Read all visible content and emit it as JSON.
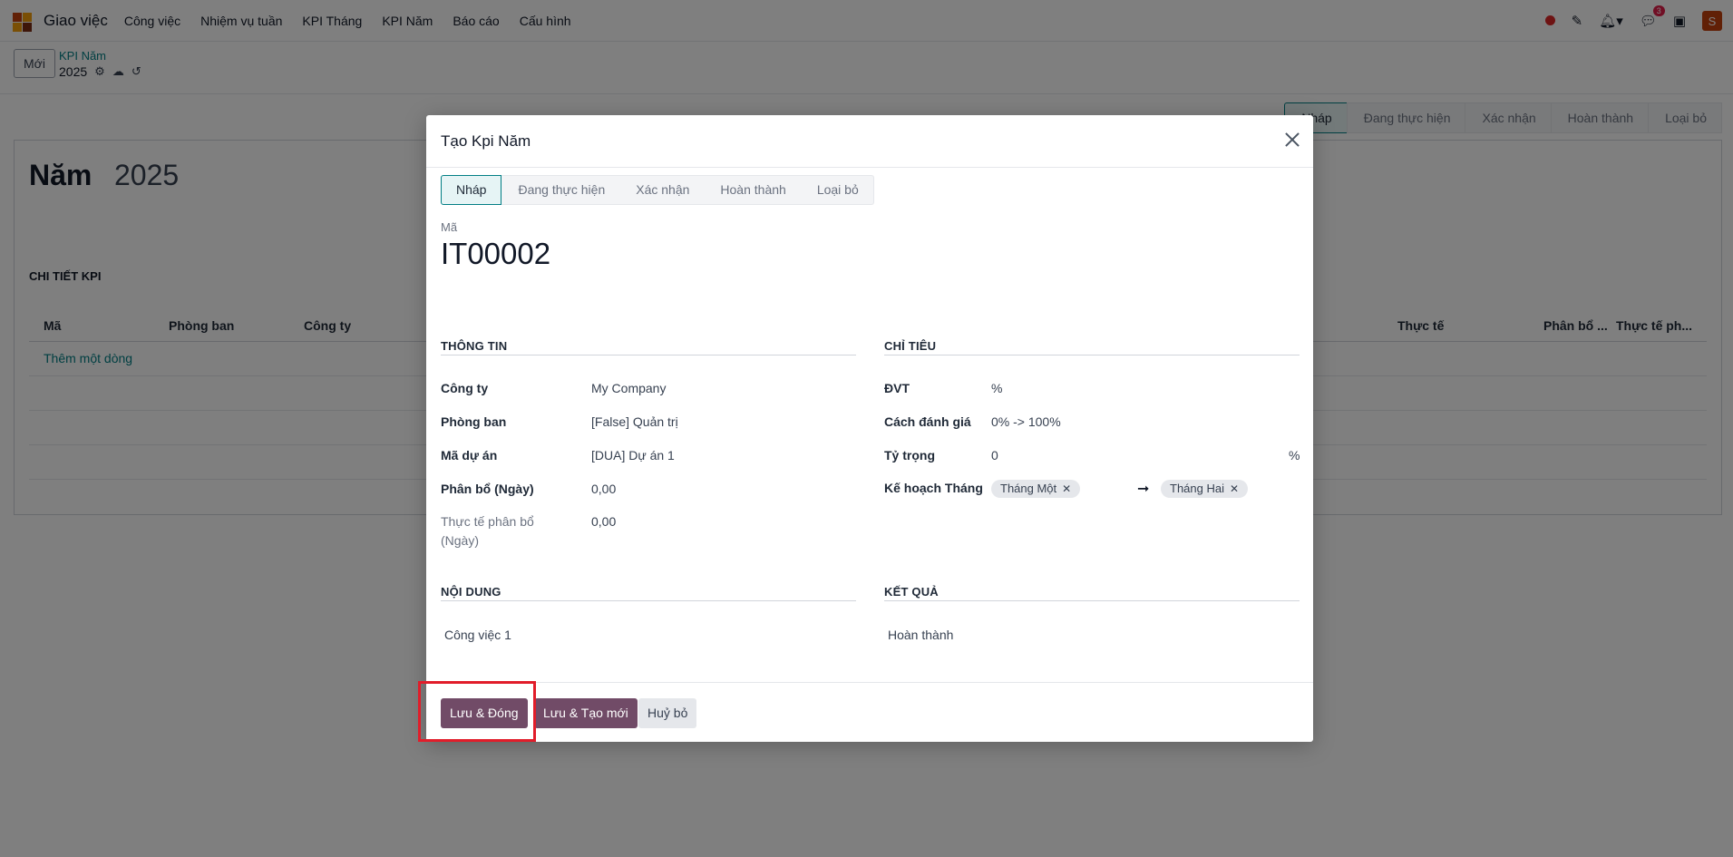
{
  "navbar": {
    "app_name": "Giao việc",
    "menu": [
      "Công việc",
      "Nhiệm vụ tuần",
      "KPI Tháng",
      "KPI Năm",
      "Báo cáo",
      "Cấu hình"
    ],
    "messages_count": "3",
    "avatar_initial": "S"
  },
  "control": {
    "new_button": "Mới",
    "breadcrumb_parent": "KPI Năm",
    "breadcrumb_current": "2025"
  },
  "background_status": [
    "Nháp",
    "Đang thực hiện",
    "Xác nhận",
    "Hoàn thành",
    "Loại bỏ"
  ],
  "sheet": {
    "title_label": "Năm",
    "title_value": "2025",
    "section": "CHI TIẾT KPI",
    "columns": [
      "Mã",
      "Phòng ban",
      "Công ty",
      "Thực tế",
      "Phân bổ ...",
      "Thực tế ph..."
    ],
    "add_line": "Thêm một dòng"
  },
  "modal": {
    "title": "Tạo Kpi Năm",
    "status": [
      "Nháp",
      "Đang thực hiện",
      "Xác nhận",
      "Hoàn thành",
      "Loại bỏ"
    ],
    "code_label": "Mã",
    "code_value": "IT00002",
    "info": {
      "title": "THÔNG TIN",
      "company_label": "Công ty",
      "company_value": "My Company",
      "department_label": "Phòng ban",
      "department_value": "[False] Quản trị",
      "project_label": "Mã dự án",
      "project_value": "[DUA] Dự án 1",
      "allocation_label": "Phân bổ (Ngày)",
      "allocation_value": "0,00",
      "actual_label_1": "Thực tế phân bổ",
      "actual_label_2": "(Ngày)",
      "actual_value": "0,00"
    },
    "target": {
      "title": "CHỈ TIÊU",
      "unit_label": "ĐVT",
      "unit_value": "%",
      "method_label": "Cách đánh giá",
      "method_value": "0% -> 100%",
      "weight_label": "Tỷ trọng",
      "weight_value": "0",
      "weight_unit": "%",
      "plan_label": "Kế hoạch Tháng",
      "plan_from": "Tháng Một",
      "plan_to": "Tháng Hai"
    },
    "content": {
      "title": "NỘI DUNG",
      "value": "Công việc 1"
    },
    "result": {
      "title": "KẾT QUẢ",
      "value": "Hoàn thành"
    },
    "buttons": {
      "save_close": "Lưu & Đóng",
      "save_new": "Lưu & Tạo mới",
      "cancel": "Huỷ bỏ"
    }
  },
  "colors": {
    "primary": "#714b67",
    "link": "#017e84",
    "highlight": "#e11d2a"
  }
}
